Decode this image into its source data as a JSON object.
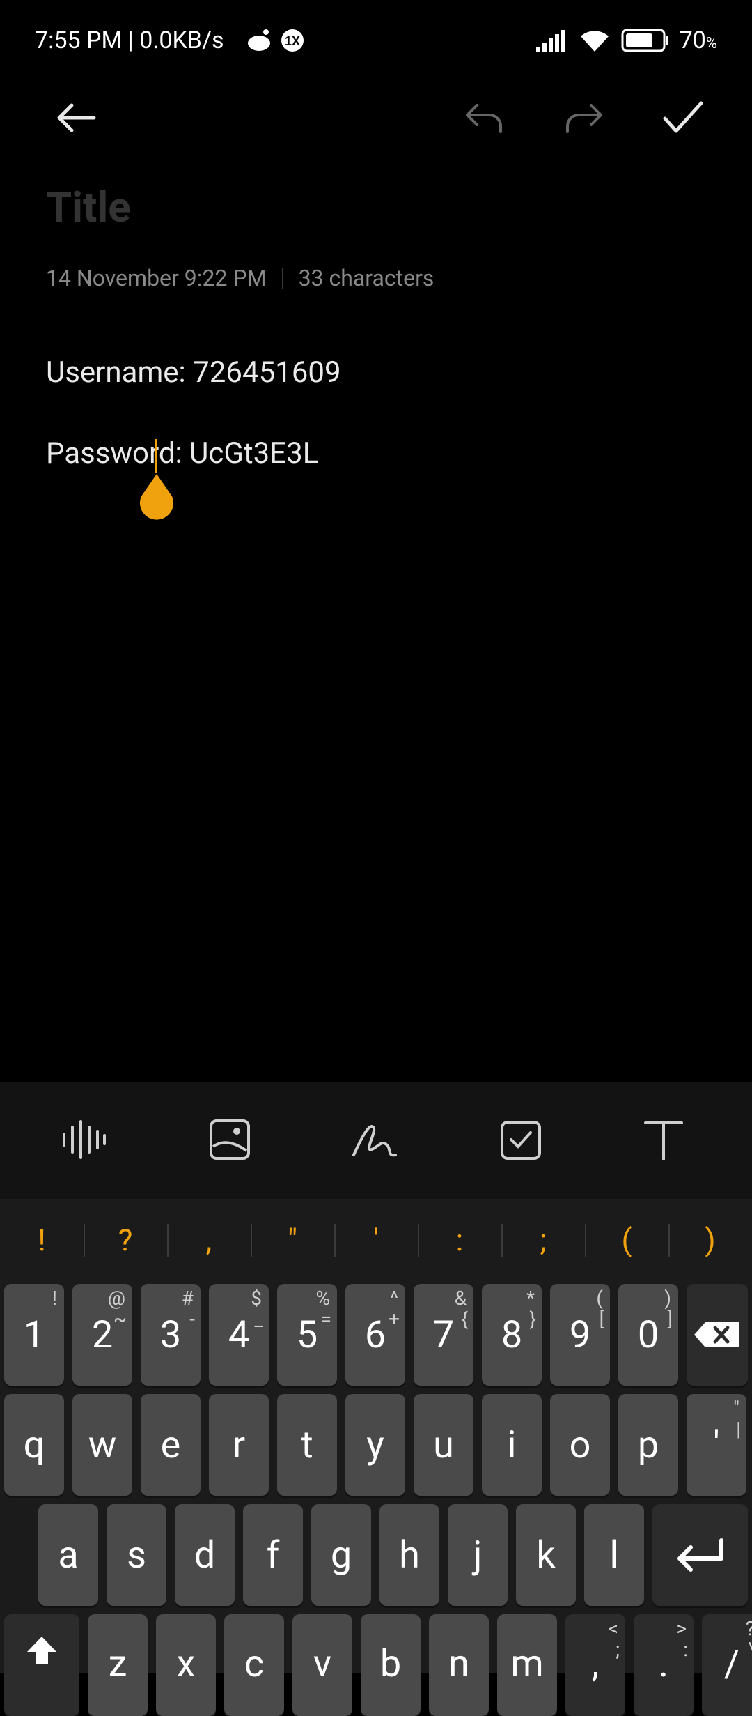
{
  "status_bar": {
    "time_speed": "7:55 PM | 0.0KB/s",
    "battery_percent": "70",
    "battery_suffix": "%"
  },
  "toolbar": {
    "back_icon": "arrow-left-icon",
    "undo_icon": "undo-icon",
    "redo_icon": "redo-icon",
    "done_icon": "check-icon"
  },
  "note": {
    "title_placeholder": "Title",
    "date": "14 November 9:22 PM",
    "char_count": "33 characters",
    "line1": "Username: 726451609",
    "line2": "Password: UcGt3E3L"
  },
  "editor_tools": [
    "voice-icon",
    "image-icon",
    "draw-icon",
    "checklist-icon",
    "text-format-icon"
  ],
  "keyboard": {
    "symbols": [
      "!",
      "?",
      ",",
      "\"",
      "'",
      ":",
      ";",
      "(",
      ")"
    ],
    "number_row": [
      {
        "main": "1",
        "top": "!",
        "side": ""
      },
      {
        "main": "2",
        "top": "@",
        "side": "~"
      },
      {
        "main": "3",
        "top": "#",
        "side": "-"
      },
      {
        "main": "4",
        "top": "$",
        "side": "_"
      },
      {
        "main": "5",
        "top": "%",
        "side": "="
      },
      {
        "main": "6",
        "top": "^",
        "side": "+"
      },
      {
        "main": "7",
        "top": "&",
        "side": "{"
      },
      {
        "main": "8",
        "top": "*",
        "side": "}"
      },
      {
        "main": "9",
        "top": "(",
        "side": "["
      },
      {
        "main": "0",
        "top": ")",
        "side": "]"
      }
    ],
    "row_q": [
      "q",
      "w",
      "e",
      "r",
      "t",
      "y",
      "u",
      "i",
      "o",
      "p",
      "'"
    ],
    "row_a": [
      "a",
      "s",
      "d",
      "f",
      "g",
      "h",
      "j",
      "k",
      "l"
    ],
    "row_z": [
      "z",
      "x",
      "c",
      "v",
      "b",
      "n",
      "m"
    ],
    "row_z_extra": [
      {
        "main": ",",
        "top": "<",
        "side": ";"
      },
      {
        "main": ".",
        "top": ">",
        "side": ":"
      },
      {
        "main": "/",
        "top": "?",
        "side": "\\"
      }
    ],
    "apostrophe_alt": "\"",
    "apostrophe_alt2": "|"
  }
}
